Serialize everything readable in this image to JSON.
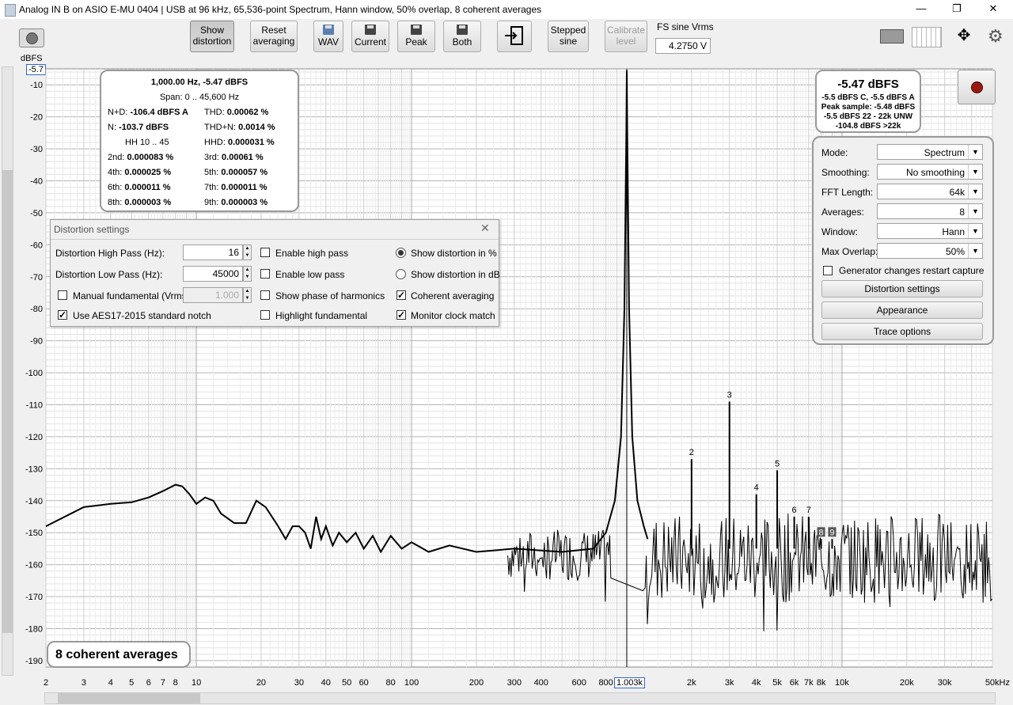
{
  "window": {
    "title": "Analog IN B on ASIO E-MU 0404 | USB at 96 kHz, 65,536-point Spectrum, Hann window, 50% overlap, 8 coherent averages",
    "minimize": "—",
    "restore": "❐",
    "close": "✕"
  },
  "toolbar": {
    "show_distortion": [
      "Show",
      "distortion"
    ],
    "reset_averaging": [
      "Reset",
      "averaging"
    ],
    "wav": "WAV",
    "current": "Current",
    "peak": "Peak",
    "both": "Both",
    "stepped_sine": [
      "Stepped",
      "sine"
    ],
    "calibrate_level": [
      "Calibrate",
      "level"
    ],
    "fs_label": "FS sine Vrms",
    "fs_value": "4.2750 V"
  },
  "chart_data": {
    "type": "line",
    "ylabel": "dBFS",
    "y_readout": "-5.7",
    "x_readout": "1.003k",
    "xscale": "log",
    "xlim": [
      2,
      50000
    ],
    "ylim": [
      -192,
      -5
    ],
    "grid": true,
    "y_ticks": [
      "-10",
      "-20",
      "-30",
      "-40",
      "-50",
      "-60",
      "-70",
      "-80",
      "-90",
      "-100",
      "-110",
      "-120",
      "-130",
      "-140",
      "-150",
      "-160",
      "-170",
      "-180",
      "-190"
    ],
    "x_ticks": [
      {
        "v": 2,
        "l": "2"
      },
      {
        "v": 3,
        "l": "3"
      },
      {
        "v": 4,
        "l": "4"
      },
      {
        "v": 5,
        "l": "5"
      },
      {
        "v": 6,
        "l": "6"
      },
      {
        "v": 7,
        "l": "7"
      },
      {
        "v": 8,
        "l": "8"
      },
      {
        "v": 10,
        "l": "10"
      },
      {
        "v": 20,
        "l": "20"
      },
      {
        "v": 30,
        "l": "30"
      },
      {
        "v": 40,
        "l": "40"
      },
      {
        "v": 50,
        "l": "50"
      },
      {
        "v": 60,
        "l": "60"
      },
      {
        "v": 80,
        "l": "80"
      },
      {
        "v": 100,
        "l": "100"
      },
      {
        "v": 200,
        "l": "200"
      },
      {
        "v": 300,
        "l": "300"
      },
      {
        "v": 400,
        "l": "400"
      },
      {
        "v": 600,
        "l": "600"
      },
      {
        "v": 800,
        "l": "800"
      },
      {
        "v": 2000,
        "l": "2k"
      },
      {
        "v": 3000,
        "l": "3k"
      },
      {
        "v": 4000,
        "l": "4k"
      },
      {
        "v": 5000,
        "l": "5k"
      },
      {
        "v": 6000,
        "l": "6k"
      },
      {
        "v": 7000,
        "l": "7k"
      },
      {
        "v": 8000,
        "l": "8k"
      },
      {
        "v": 10000,
        "l": "10k"
      },
      {
        "v": 20000,
        "l": "20k"
      },
      {
        "v": 30000,
        "l": "30k"
      },
      {
        "v": 50000,
        "l": "50kHz"
      }
    ],
    "lowfreq_curve": [
      [
        2,
        -148
      ],
      [
        3,
        -142
      ],
      [
        4,
        -141
      ],
      [
        5,
        -140.5
      ],
      [
        6,
        -139
      ],
      [
        7,
        -137
      ],
      [
        8,
        -135
      ],
      [
        8.6,
        -135.5
      ],
      [
        9.3,
        -138
      ],
      [
        10,
        -141
      ],
      [
        11,
        -139
      ],
      [
        12,
        -140
      ],
      [
        13,
        -144
      ],
      [
        15,
        -147
      ],
      [
        17,
        -147
      ],
      [
        19,
        -140
      ],
      [
        21,
        -142
      ],
      [
        24,
        -148
      ],
      [
        26,
        -152
      ],
      [
        28,
        -148
      ],
      [
        30,
        -148
      ],
      [
        32,
        -150
      ],
      [
        34,
        -155
      ],
      [
        36,
        -145
      ],
      [
        38,
        -152
      ],
      [
        40,
        -148
      ],
      [
        43,
        -154
      ],
      [
        46,
        -150
      ],
      [
        50,
        -153
      ],
      [
        55,
        -150
      ],
      [
        60,
        -155
      ],
      [
        66,
        -151
      ],
      [
        72,
        -156
      ],
      [
        80,
        -151
      ],
      [
        90,
        -155
      ],
      [
        100,
        -153
      ],
      [
        120,
        -156
      ],
      [
        150,
        -154
      ],
      [
        200,
        -156
      ],
      [
        300,
        -155
      ],
      [
        500,
        -156
      ],
      [
        700,
        -155
      ],
      [
        800,
        -150
      ],
      [
        880,
        -140
      ],
      [
        940,
        -120
      ],
      [
        975,
        -80
      ],
      [
        995,
        -25
      ],
      [
        1000,
        -5.5
      ],
      [
        1005,
        -25
      ],
      [
        1025,
        -80
      ],
      [
        1060,
        -120
      ],
      [
        1120,
        -140
      ],
      [
        1200,
        -148
      ],
      [
        1250,
        -152
      ]
    ],
    "harmonics": [
      {
        "n": "2",
        "freq": 2000,
        "level": -127
      },
      {
        "n": "3",
        "freq": 3000,
        "level": -109
      },
      {
        "n": "4",
        "freq": 4000,
        "level": -138
      },
      {
        "n": "5",
        "freq": 5000,
        "level": -130.5
      },
      {
        "n": "6",
        "freq": 6000,
        "level": -145
      },
      {
        "n": "7",
        "freq": 7000,
        "level": -145
      },
      {
        "n": "8",
        "freq": 8000,
        "level": -152
      },
      {
        "n": "9",
        "freq": 9000,
        "level": -152
      }
    ],
    "series": [
      {
        "values": []
      }
    ]
  },
  "harmonics_panel": {
    "fundamental": "1,000.00 Hz, -5.47 dBFS",
    "span": "Span: 0 .. 45,600 Hz",
    "rows": [
      {
        "l1": "N+D:",
        "v1": "-106.4 dBFS A",
        "l2": "THD:",
        "v2": "0.00062 %"
      },
      {
        "l1": "N:",
        "v1": "-103.7 dBFS",
        "l2": "THD+N:",
        "v2": "0.0014 %"
      },
      {
        "l1": "HH 10 .. 45",
        "v1": "",
        "l2": "HHD:",
        "v2": "0.000031 %"
      },
      {
        "l1": "2nd:",
        "v1": "0.000083 %",
        "l2": "3rd:",
        "v2": "0.00061 %"
      },
      {
        "l1": "4th:",
        "v1": "0.000025 %",
        "l2": "5th:",
        "v2": "0.000057 %"
      },
      {
        "l1": "6th:",
        "v1": "0.000011 %",
        "l2": "7th:",
        "v2": "0.000011 %"
      },
      {
        "l1": "8th:",
        "v1": "0.000003 %",
        "l2": "9th:",
        "v2": "0.000003 %"
      }
    ]
  },
  "level_panel": {
    "main": "-5.47 dBFS",
    "lines": [
      "-5.5 dBFS C, -5.5 dBFS A",
      "Peak sample: -5.48 dBFS",
      "-5.5 dBFS 22 - 22k UNW",
      "-104.8 dBFS >22k"
    ]
  },
  "settings_panel": {
    "rows": [
      {
        "label": "Mode:",
        "value": "Spectrum"
      },
      {
        "label": "Smoothing:",
        "value": "No  smoothing"
      },
      {
        "label": "FFT Length:",
        "value": "64k"
      },
      {
        "label": "Averages:",
        "value": "8"
      },
      {
        "label": "Window:",
        "value": "Hann"
      },
      {
        "label": "Max Overlap:",
        "value": "50%"
      }
    ],
    "restart_capture": "Generator changes restart capture",
    "distortion_settings": "Distortion settings",
    "appearance": "Appearance",
    "trace_options": "Trace options"
  },
  "dialog": {
    "title": "Distortion settings",
    "high_pass_label": "Distortion High Pass (Hz):",
    "high_pass_value": "16",
    "low_pass_label": "Distortion Low Pass (Hz):",
    "low_pass_value": "45000",
    "manual_fund": "Manual fundamental (Vrms)",
    "manual_fund_value": "1.000",
    "aes17": "Use AES17-2015 standard notch",
    "enable_high_pass": "Enable high pass",
    "enable_low_pass": "Enable low pass",
    "show_phase": "Show phase of harmonics",
    "highlight_fund": "Highlight fundamental",
    "show_pct": "Show distortion in %",
    "show_db": "Show distortion in dB",
    "coherent": "Coherent averaging",
    "monitor_clock": "Monitor clock match"
  },
  "averages_badge": "8 coherent averages"
}
